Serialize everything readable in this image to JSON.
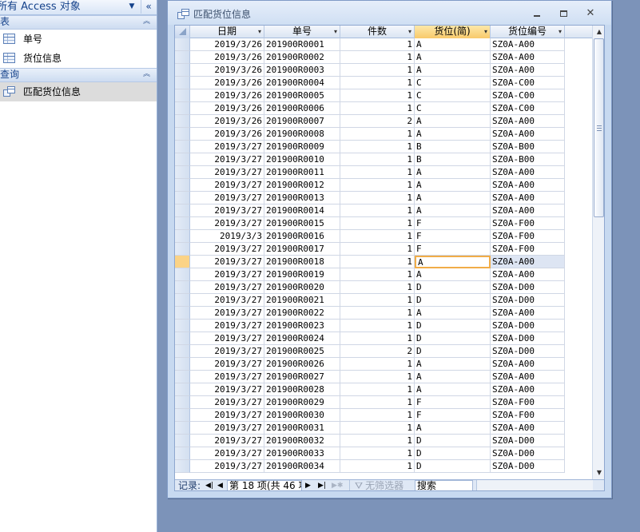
{
  "nav": {
    "title": "所有 Access 对象",
    "dropdown_glyph": "▼",
    "collapse_glyph": "«",
    "groups": [
      {
        "label": "表",
        "chevron": "︽",
        "items": [
          {
            "label": "单号",
            "icon": "table-icon"
          },
          {
            "label": "货位信息",
            "icon": "table-icon"
          }
        ]
      },
      {
        "label": "查询",
        "chevron": "︽",
        "items": [
          {
            "label": "匹配货位信息",
            "icon": "query-icon",
            "selected": true
          }
        ]
      }
    ]
  },
  "window": {
    "title": "匹配货位信息",
    "min_glyph": "",
    "max_glyph": "",
    "close_glyph": "✕"
  },
  "grid": {
    "columns": [
      {
        "label": "日期",
        "arrow": "▾"
      },
      {
        "label": "单号",
        "arrow": "▾"
      },
      {
        "label": "件数",
        "arrow": "▾"
      },
      {
        "label": "货位(简)",
        "arrow": "▾",
        "sorted": true
      },
      {
        "label": "货位编号",
        "arrow": "▾"
      }
    ],
    "current_row_index": 17,
    "rows": [
      [
        "2019/3/26",
        "201900R0001",
        "1",
        "A",
        "SZ0A-A00"
      ],
      [
        "2019/3/26",
        "201900R0002",
        "1",
        "A",
        "SZ0A-A00"
      ],
      [
        "2019/3/26",
        "201900R0003",
        "1",
        "A",
        "SZ0A-A00"
      ],
      [
        "2019/3/26",
        "201900R0004",
        "1",
        "C",
        "SZ0A-C00"
      ],
      [
        "2019/3/26",
        "201900R0005",
        "1",
        "C",
        "SZ0A-C00"
      ],
      [
        "2019/3/26",
        "201900R0006",
        "1",
        "C",
        "SZ0A-C00"
      ],
      [
        "2019/3/26",
        "201900R0007",
        "2",
        "A",
        "SZ0A-A00"
      ],
      [
        "2019/3/26",
        "201900R0008",
        "1",
        "A",
        "SZ0A-A00"
      ],
      [
        "2019/3/27",
        "201900R0009",
        "1",
        "B",
        "SZ0A-B00"
      ],
      [
        "2019/3/27",
        "201900R0010",
        "1",
        "B",
        "SZ0A-B00"
      ],
      [
        "2019/3/27",
        "201900R0011",
        "1",
        "A",
        "SZ0A-A00"
      ],
      [
        "2019/3/27",
        "201900R0012",
        "1",
        "A",
        "SZ0A-A00"
      ],
      [
        "2019/3/27",
        "201900R0013",
        "1",
        "A",
        "SZ0A-A00"
      ],
      [
        "2019/3/27",
        "201900R0014",
        "1",
        "A",
        "SZ0A-A00"
      ],
      [
        "2019/3/27",
        "201900R0015",
        "1",
        "F",
        "SZ0A-F00"
      ],
      [
        "2019/3/3",
        "201900R0016",
        "1",
        "F",
        "SZ0A-F00"
      ],
      [
        "2019/3/27",
        "201900R0017",
        "1",
        "F",
        "SZ0A-F00"
      ],
      [
        "2019/3/27",
        "201900R0018",
        "1",
        "A",
        "SZ0A-A00"
      ],
      [
        "2019/3/27",
        "201900R0019",
        "1",
        "A",
        "SZ0A-A00"
      ],
      [
        "2019/3/27",
        "201900R0020",
        "1",
        "D",
        "SZ0A-D00"
      ],
      [
        "2019/3/27",
        "201900R0021",
        "1",
        "D",
        "SZ0A-D00"
      ],
      [
        "2019/3/27",
        "201900R0022",
        "1",
        "A",
        "SZ0A-A00"
      ],
      [
        "2019/3/27",
        "201900R0023",
        "1",
        "D",
        "SZ0A-D00"
      ],
      [
        "2019/3/27",
        "201900R0024",
        "1",
        "D",
        "SZ0A-D00"
      ],
      [
        "2019/3/27",
        "201900R0025",
        "2",
        "D",
        "SZ0A-D00"
      ],
      [
        "2019/3/27",
        "201900R0026",
        "1",
        "A",
        "SZ0A-A00"
      ],
      [
        "2019/3/27",
        "201900R0027",
        "1",
        "A",
        "SZ0A-A00"
      ],
      [
        "2019/3/27",
        "201900R0028",
        "1",
        "A",
        "SZ0A-A00"
      ],
      [
        "2019/3/27",
        "201900R0029",
        "1",
        "F",
        "SZ0A-F00"
      ],
      [
        "2019/3/27",
        "201900R0030",
        "1",
        "F",
        "SZ0A-F00"
      ],
      [
        "2019/3/27",
        "201900R0031",
        "1",
        "A",
        "SZ0A-A00"
      ],
      [
        "2019/3/27",
        "201900R0032",
        "1",
        "D",
        "SZ0A-D00"
      ],
      [
        "2019/3/27",
        "201900R0033",
        "1",
        "D",
        "SZ0A-D00"
      ],
      [
        "2019/3/27",
        "201900R0034",
        "1",
        "D",
        "SZ0A-D00"
      ]
    ]
  },
  "scrollbar": {
    "up_glyph": "▲",
    "down_glyph": "▼"
  },
  "status": {
    "label": "记录:",
    "first_glyph": "◀|",
    "prev_glyph": "◀",
    "position_text": "第 18 项(共 46 项)",
    "next_glyph": "▶",
    "last_glyph": "▶|",
    "new_glyph": "▶✱",
    "filter_glyph": "⛛",
    "filter_text": "无筛选器",
    "search_text": "搜索"
  },
  "colors": {
    "accent_header_sorted": "#f8c96b",
    "current_row_marker": "#fbd386",
    "focus_border": "#f1ad48",
    "workspace_bg": "#7c93b9"
  }
}
